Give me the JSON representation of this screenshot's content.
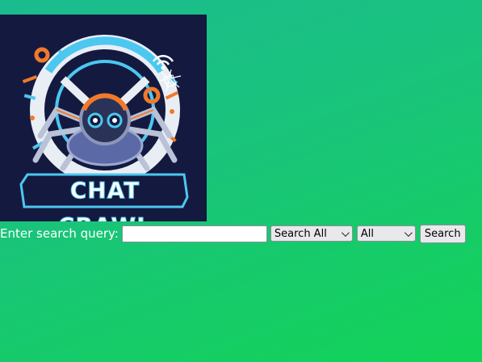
{
  "logo": {
    "text": "CHAT CRAWL",
    "colors": {
      "bg": "#141a3f",
      "orange": "#f07a2a",
      "blue": "#4cc7f0",
      "white": "#ffffff"
    }
  },
  "search": {
    "label": "Enter search query:",
    "input_value": "",
    "input_placeholder": "",
    "type_select": "Search All",
    "scope_select": "All",
    "button": "Search"
  }
}
